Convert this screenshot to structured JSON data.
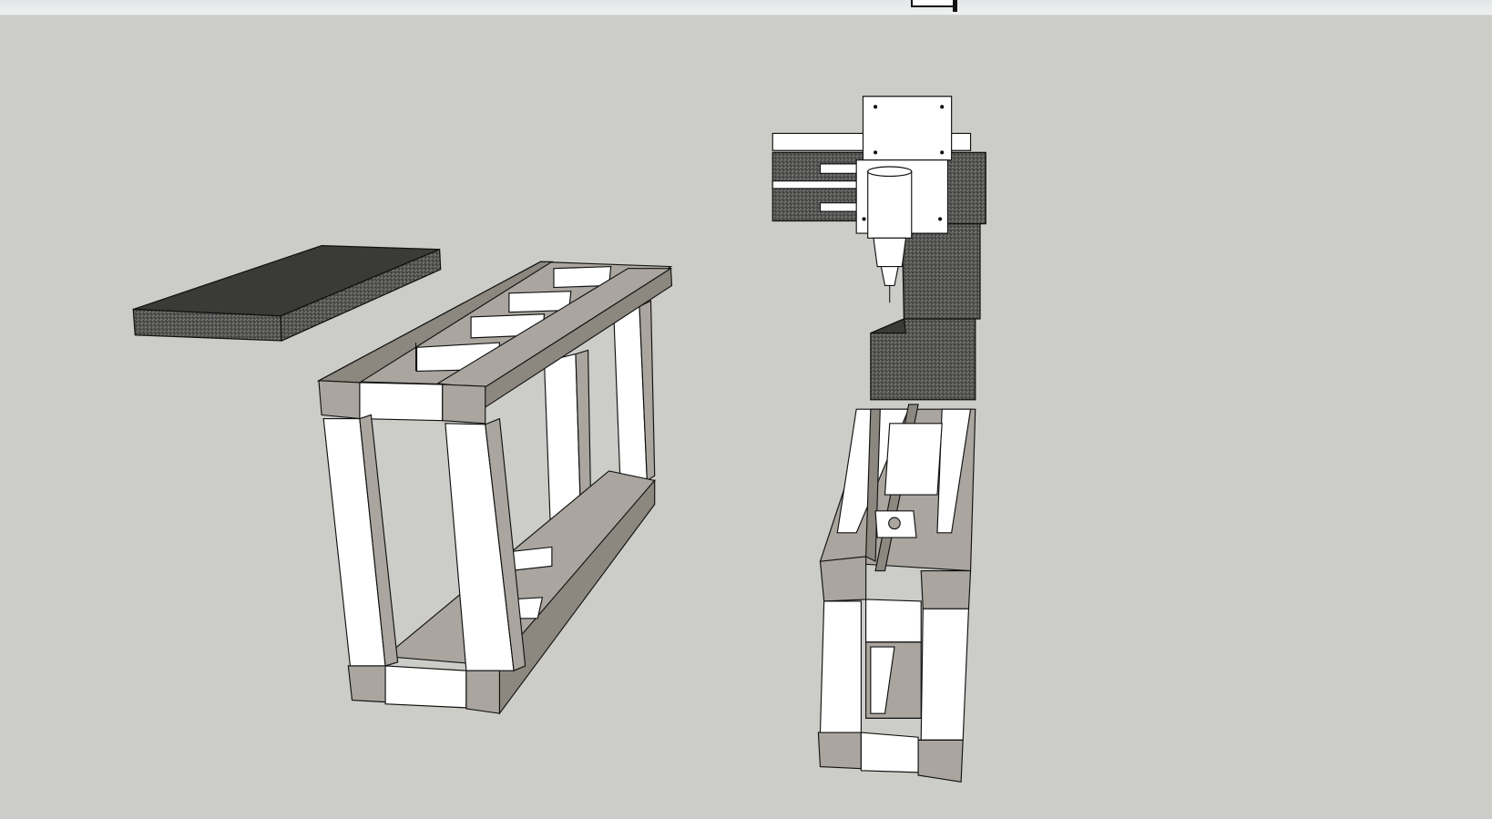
{
  "window": {
    "toolbar_visible": true
  },
  "viewport": {
    "background_color": "#cccdc8",
    "scene_objects": [
      "dark-slab",
      "table-frame",
      "cnc-machine"
    ]
  },
  "colors": {
    "face_white": "#ffffff",
    "face_gray": "#aaa69f",
    "granite": "#4a4a48",
    "edge": "#111111"
  }
}
